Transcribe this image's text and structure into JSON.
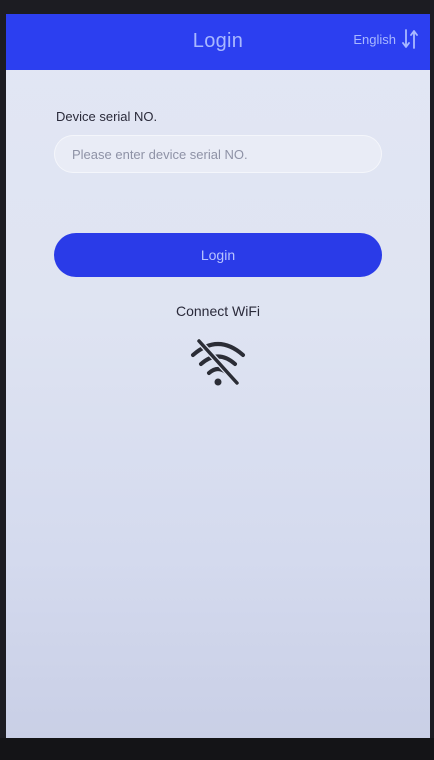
{
  "header": {
    "title": "Login",
    "language_label": "English",
    "language_icon": "swap-vertical-icon",
    "color": "#2c3ff0"
  },
  "form": {
    "serial_label": "Device serial NO.",
    "serial_placeholder": "Please enter device serial NO.",
    "serial_value": "",
    "login_button_label": "Login",
    "button_color": "#2a3be8"
  },
  "wifi": {
    "connect_label": "Connect WiFi",
    "icon": "wifi-off-icon"
  }
}
